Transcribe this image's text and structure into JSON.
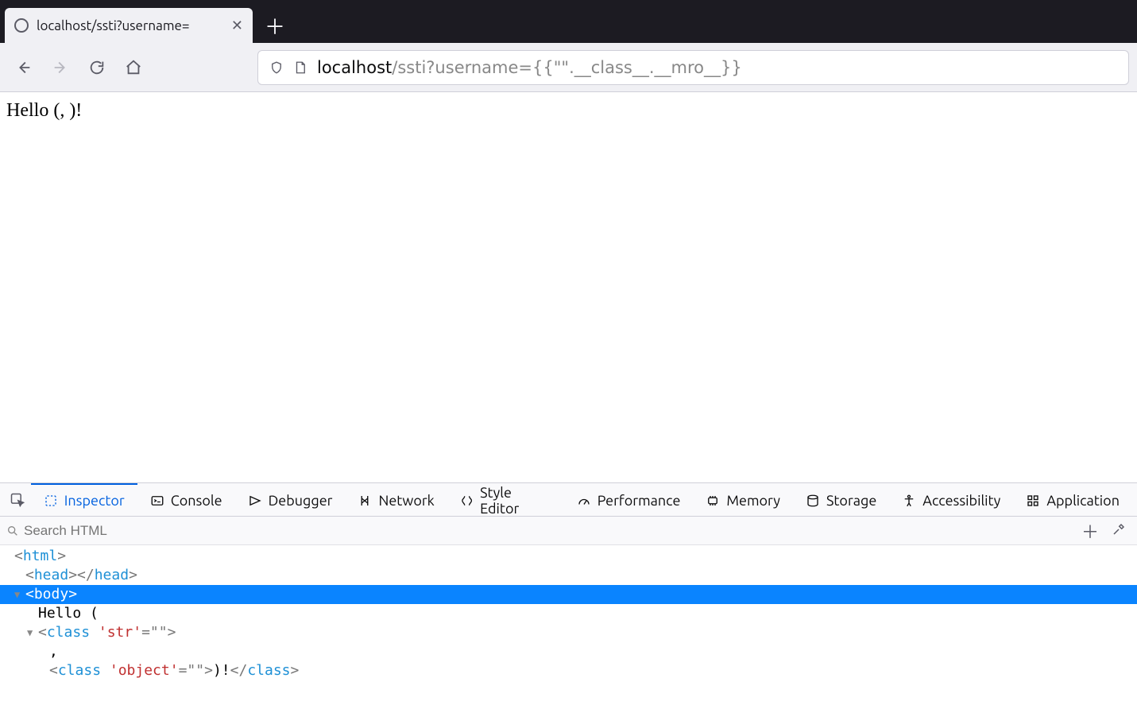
{
  "browser": {
    "tab_title": "localhost/ssti?username=",
    "url_host": "localhost",
    "url_path": "/ssti?username={{\"\".__class__.__mro__}}"
  },
  "page": {
    "body_text": "Hello (, )!"
  },
  "devtools": {
    "tabs": [
      {
        "label": "Inspector"
      },
      {
        "label": "Console"
      },
      {
        "label": "Debugger"
      },
      {
        "label": "Network"
      },
      {
        "label": "Style Editor"
      },
      {
        "label": "Performance"
      },
      {
        "label": "Memory"
      },
      {
        "label": "Storage"
      },
      {
        "label": "Accessibility"
      },
      {
        "label": "Application"
      }
    ],
    "active_tab_index": 0,
    "search_placeholder": "Search HTML",
    "dom": {
      "line0_tag": "html",
      "line1_open": "head",
      "line1_close": "head",
      "line2_tag": "body",
      "line3_text": "Hello (",
      "line4_tag": "class",
      "line4_attr": "'str'",
      "line4_val": "\"\"",
      "line5_text": ",",
      "line6_tag": "class",
      "line6_attr": "'object'",
      "line6_val": "\"\"",
      "line6_after": ")!",
      "line6_close": "class"
    }
  }
}
